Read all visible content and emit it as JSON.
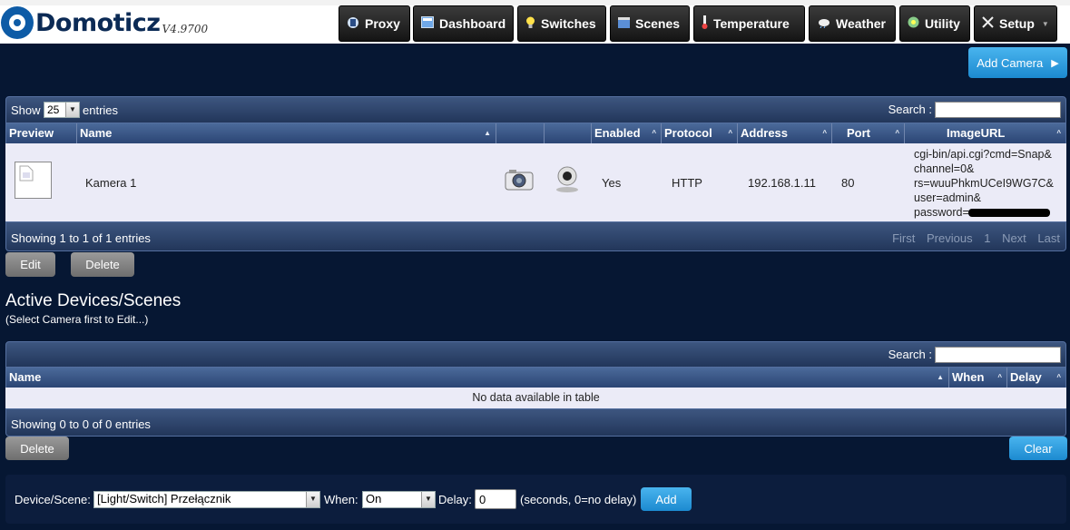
{
  "app": {
    "name": "Domoticz",
    "version": "V4.9700"
  },
  "nav": [
    {
      "label": "Proxy",
      "icon": "proxy-icon"
    },
    {
      "label": "Dashboard",
      "icon": "dashboard-icon"
    },
    {
      "label": "Switches",
      "icon": "lightbulb-icon"
    },
    {
      "label": "Scenes",
      "icon": "clapper-icon"
    },
    {
      "label": "Temperature",
      "icon": "thermometer-icon"
    },
    {
      "label": "Weather",
      "icon": "weather-icon"
    },
    {
      "label": "Utility",
      "icon": "utility-icon"
    },
    {
      "label": "Setup",
      "icon": "tools-icon"
    }
  ],
  "add_camera": "Add Camera",
  "camera_table": {
    "show_label": "Show",
    "page_size": "25",
    "entries_label": "entries",
    "search_label": "Search :",
    "columns": [
      "Preview",
      "Name",
      "Enabled",
      "Protocol",
      "Address",
      "Port",
      "ImageURL"
    ],
    "rows": [
      {
        "name": "Kamera 1",
        "enabled": "Yes",
        "protocol": "HTTP",
        "address": "192.168.1.11",
        "port": "80",
        "image_url": [
          "cgi-bin/api.cgi?cmd=Snap&",
          "channel=0&",
          "rs=wuuPhkmUCeI9WG7C&",
          "user=admin&",
          "password="
        ]
      }
    ],
    "info": "Showing 1 to 1 of 1 entries",
    "pager": {
      "first": "First",
      "previous": "Previous",
      "page": "1",
      "next": "Next",
      "last": "Last"
    }
  },
  "camera_actions": {
    "edit": "Edit",
    "delete": "Delete"
  },
  "active_devices": {
    "title": "Active Devices/Scenes",
    "subtitle": "(Select Camera first to Edit...)",
    "search_label": "Search :",
    "columns": [
      "Name",
      "When",
      "Delay"
    ],
    "empty": "No data available in table",
    "info": "Showing 0 to 0 of 0 entries",
    "delete": "Delete",
    "clear": "Clear"
  },
  "add_form": {
    "device_label": "Device/Scene:",
    "device_value": "[Light/Switch] Przełącznik",
    "when_label": "When:",
    "when_value": "On",
    "delay_label": "Delay:",
    "delay_value": "0",
    "delay_hint": "(seconds, 0=no delay)",
    "add": "Add"
  }
}
